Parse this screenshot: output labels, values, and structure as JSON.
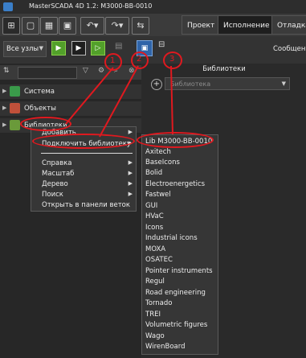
{
  "window": {
    "title": "MasterSCADA 4D 1.2: M3000-BB-0010"
  },
  "tabs": [
    {
      "label": "Проект"
    },
    {
      "label": "Исполнение"
    },
    {
      "label": "Отладка"
    }
  ],
  "toolbar2": {
    "nodes_select": "Все узлы",
    "messages_label": "Сообщен"
  },
  "left_panel": {
    "tree": [
      {
        "label": "Система"
      },
      {
        "label": "Объекты"
      },
      {
        "label": "Библиотеки"
      }
    ]
  },
  "context_menu": {
    "items": [
      {
        "label": "Добавить",
        "has_submenu": true
      },
      {
        "label": "Подключить библиотеку",
        "has_submenu": true
      },
      {
        "label": "Справка",
        "has_submenu": true
      },
      {
        "label": "Масштаб",
        "has_submenu": true
      },
      {
        "label": "Дерево",
        "has_submenu": true
      },
      {
        "label": "Поиск",
        "has_submenu": true
      },
      {
        "label": "Открыть в панели веток",
        "has_submenu": false
      }
    ]
  },
  "library_submenu": {
    "items": [
      "Lib M3000-BB-0010",
      "Axitech",
      "BaseIcons",
      "Bolid",
      "Electroenergetics",
      "Fastwel",
      "GUI",
      "HVaC",
      "Icons",
      "Industrial icons",
      "MOXA",
      "OSATEC",
      "Pointer instruments",
      "Regul",
      "Road engineering",
      "Tornado",
      "TREI",
      "Volumetric figures",
      "Wago",
      "WirenBoard"
    ]
  },
  "right_panel": {
    "header": "Библиотеки",
    "combo_placeholder": "Библиотека"
  },
  "annotations": {
    "n1": "1",
    "n2": "2",
    "n3": "3"
  },
  "colors": {
    "annotation": "#e0191f",
    "green_button": "#52a02a",
    "blue_button": "#2f64a8"
  }
}
